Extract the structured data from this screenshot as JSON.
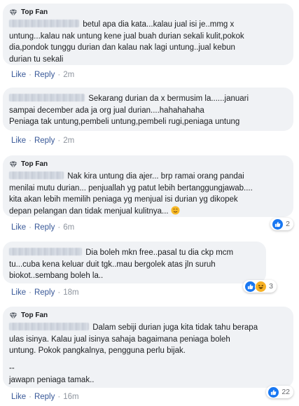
{
  "labels": {
    "top_fan": "Top Fan",
    "like": "Like",
    "reply": "Reply",
    "separator": "·"
  },
  "colors": {
    "bubble": "#f0f2f5",
    "link": "#385898",
    "like_blue": "#1877f2",
    "haha_yellow": "#f7b125"
  },
  "comments": [
    {
      "top_fan": true,
      "lines": [
        "betul apa dia kata...kalau jual isi je..mmg x",
        "untung...kalau nak untung kene jual buah durian sekali kulit,pokok",
        "dia,pondok tunggu durian dan kalau nak lagi untung..jual kebun",
        "durian tu sekali"
      ],
      "time": "2m"
    },
    {
      "top_fan": false,
      "lines": [
        "Sekarang durian da x bermusim la......januari",
        "sampai december ada ja org jual durian....hahahahaha",
        "Peniaga tak untung,pembeli untung,pembeli rugi,peniaga untung"
      ],
      "time": "2m"
    },
    {
      "top_fan": true,
      "lines": [
        "Nak kira untung dia ajer... brp ramai orang pandai",
        "menilai mutu durian... penjuallah yg patut lebih bertanggungjawab....",
        "kita akan lebih memilih peniaga yg menjual isi durian yg dikopek",
        "depan pelangan dan tidak menjual kulitnya..."
      ],
      "time": "6m",
      "reaction_icons": [
        "like-icon"
      ],
      "reaction_count": "2"
    },
    {
      "top_fan": false,
      "lines": [
        "Dia boleh mkn free..pasal tu dia ckp mcm",
        "tu...cuba kena keluar duit tgk..mau bergolek atas jln suruh",
        "biokot..sembang boleh la.."
      ],
      "time": "18m",
      "reaction_icons": [
        "like-icon",
        "haha-icon"
      ],
      "reaction_count": "3"
    },
    {
      "top_fan": true,
      "lines": [
        "Dalam sebiji durian juga kita tidak tahu berapa",
        "ulas isinya. Kalau jual isinya sahaja bagaimana peniaga boleh",
        "untung. Pokok pangkalnya, pengguna perlu bijak.",
        "",
        "--",
        "jawapn peniaga tamak.."
      ],
      "time": "16m",
      "reaction_icons": [
        "like-icon"
      ],
      "reaction_count": "22"
    }
  ]
}
